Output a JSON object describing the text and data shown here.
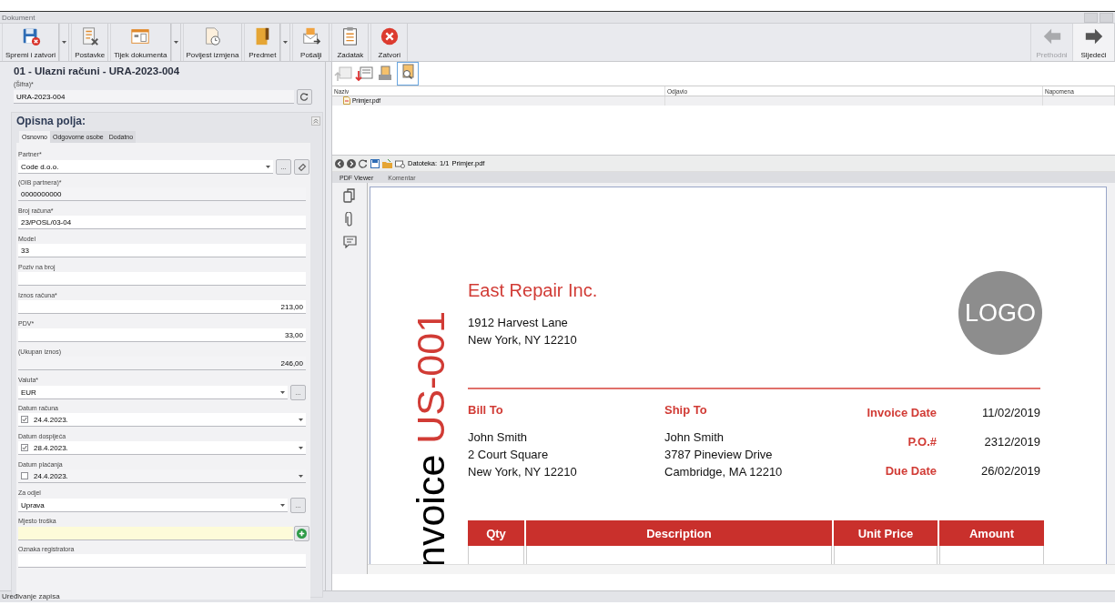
{
  "window": {
    "title": "Dokument"
  },
  "toolbar": {
    "buttons": [
      {
        "label": "Spremi i zatvori",
        "dropdown": true
      },
      {
        "label": "Postavke",
        "dropdown": false
      },
      {
        "label": "Tijek dokumenta",
        "dropdown": true
      },
      {
        "label": "Povijest izmjena",
        "dropdown": false
      },
      {
        "label": "Predmet",
        "dropdown": true
      },
      {
        "label": "Pošalji",
        "dropdown": false
      },
      {
        "label": "Zadatak",
        "dropdown": false
      },
      {
        "label": "Zatvori",
        "dropdown": false
      }
    ],
    "nav_buttons": [
      {
        "label": "Prethodni",
        "disabled": true
      },
      {
        "label": "Sljedeći",
        "disabled": false
      }
    ]
  },
  "form": {
    "title": "01 - Ulazni računi - URA-2023-004",
    "code_field": {
      "label": "(Šifra)*",
      "value": "URA-2023-004"
    },
    "section_title": "Opisna polja:",
    "tabs": [
      {
        "label": "Osnovno",
        "selected": true
      },
      {
        "label": "Odgovorne osobe",
        "selected": false
      },
      {
        "label": "Dodatno",
        "selected": false
      }
    ],
    "fields": [
      {
        "kind": "combo_link",
        "label": "Partner*",
        "value": "Code d.o.o.",
        "more_button": "..."
      },
      {
        "kind": "readonly",
        "label": "(OIB partnera)*",
        "value": "0000000000"
      },
      {
        "kind": "text",
        "label": "Broj računa*",
        "value": "23/POSL/03-04"
      },
      {
        "kind": "text",
        "label": "Model",
        "value": "33"
      },
      {
        "kind": "text",
        "label": "Poziv na broj"
      },
      {
        "kind": "amount",
        "label": "Iznos računa*",
        "value": "213,00"
      },
      {
        "kind": "amount",
        "label": "PDV*",
        "value": "33,00"
      },
      {
        "kind": "readonly_amount",
        "label": "(Ukupan iznos)",
        "value": "246,00"
      },
      {
        "kind": "combo",
        "label": "Valuta*",
        "value": "EUR",
        "more_button": "..."
      },
      {
        "kind": "date",
        "label": "Datum računa",
        "value": "24.4.2023.",
        "checked": true
      },
      {
        "kind": "date",
        "label": "Datum dospijeća",
        "value": "28.4.2023.",
        "checked": true
      },
      {
        "kind": "date",
        "label": "Datum plaćanja",
        "value": "24.4.2023.",
        "checked": false
      },
      {
        "kind": "combo",
        "label": "Za odjel",
        "value": "Uprava",
        "more_button": "..."
      },
      {
        "kind": "lookup",
        "label": "Mjesto troška"
      },
      {
        "kind": "text",
        "label": "Oznaka registratora"
      }
    ]
  },
  "attachments": {
    "columns": [
      "Naziv",
      "Odjavio",
      "Napomena"
    ],
    "rows": [
      {
        "name": "Primjer.pdf"
      }
    ]
  },
  "viewer": {
    "file_label": "Datoteka:",
    "page_count": "1/1",
    "file_name": "Primjer.pdf",
    "tabs": [
      {
        "label": "PDF Viewer",
        "selected": true
      },
      {
        "label": "Komentar",
        "selected": false
      }
    ]
  },
  "invoice": {
    "title_word": "nvoice",
    "title_number": "US-001",
    "company": "East Repair Inc.",
    "address": [
      "1912 Harvest Lane",
      "New York, NY 12210"
    ],
    "logo": "LOGO",
    "bill_to": {
      "heading": "Bill To",
      "lines": [
        "John Smith",
        "2 Court Square",
        "New York, NY 12210"
      ]
    },
    "ship_to": {
      "heading": "Ship To",
      "lines": [
        "John Smith",
        "3787 Pineview Drive",
        "Cambridge, MA 12210"
      ]
    },
    "meta": [
      {
        "label": "Invoice Date",
        "value": "11/02/2019"
      },
      {
        "label": "P.O.#",
        "value": "2312/2019"
      },
      {
        "label": "Due Date",
        "value": "26/02/2019"
      }
    ],
    "table_columns": [
      "Qty",
      "Description",
      "Unit Price",
      "Amount"
    ]
  },
  "status_bar": "Uređivanje zapisa"
}
